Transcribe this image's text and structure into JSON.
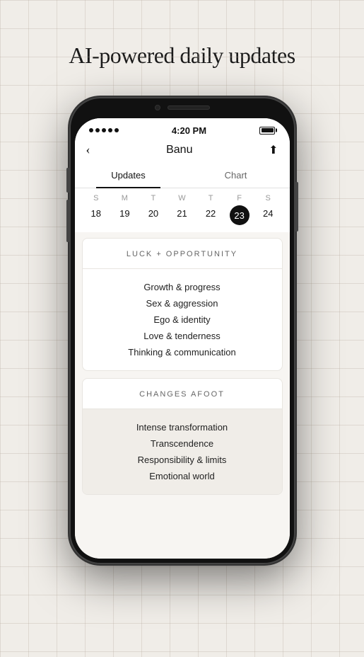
{
  "page": {
    "title": "AI-powered daily updates",
    "background_color": "#f0ede8"
  },
  "phone": {
    "status_bar": {
      "time": "4:20 PM",
      "signal_dots": 5
    },
    "nav": {
      "back_label": "‹",
      "title": "Banu",
      "share_label": "⬆"
    },
    "tabs": [
      {
        "label": "Updates",
        "active": true
      },
      {
        "label": "Chart",
        "active": false
      }
    ],
    "calendar": {
      "day_labels": [
        "S",
        "M",
        "T",
        "W",
        "T",
        "F",
        "S"
      ],
      "dates": [
        {
          "date": "18",
          "today": false
        },
        {
          "date": "19",
          "today": false
        },
        {
          "date": "20",
          "today": false
        },
        {
          "date": "21",
          "today": false
        },
        {
          "date": "22",
          "today": false
        },
        {
          "date": "23",
          "today": true
        },
        {
          "date": "24",
          "today": false
        }
      ]
    },
    "cards": [
      {
        "id": "luck-opportunity",
        "header": "LUCK + OPPORTUNITY",
        "items": [
          "Growth & progress",
          "Sex & aggression",
          "Ego & identity",
          "Love & tenderness",
          "Thinking & communication"
        ]
      },
      {
        "id": "changes-afoot",
        "header": "CHANGES AFOOT",
        "items": [
          "Intense transformation",
          "Transcendence",
          "Responsibility & limits",
          "Emotional world"
        ]
      }
    ]
  }
}
